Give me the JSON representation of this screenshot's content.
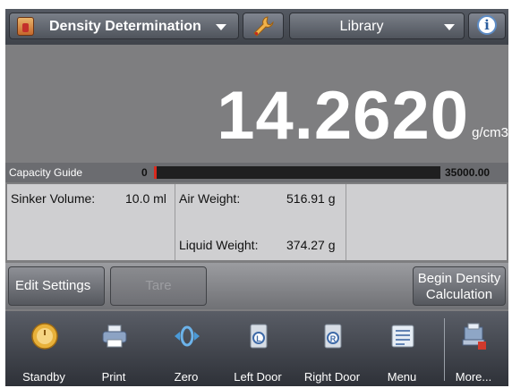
{
  "header": {
    "mode_label": "Density Determination",
    "library_label": "Library"
  },
  "reading": {
    "value": "14.2620",
    "unit": "g/cm3"
  },
  "capacity": {
    "label": "Capacity Guide",
    "min": "0",
    "max": "35000.00",
    "fill_fraction": 0.005
  },
  "details": {
    "sinker_label": "Sinker Volume:",
    "sinker_value": "10.0 ml",
    "air_label": "Air Weight:",
    "air_value": "516.91 g",
    "liquid_label": "Liquid Weight:",
    "liquid_value": "374.27 g"
  },
  "actions": {
    "edit_settings": "Edit Settings",
    "tare": "Tare",
    "begin_line1": "Begin Density",
    "begin_line2": "Calculation"
  },
  "nav": {
    "standby": "Standby",
    "print": "Print",
    "zero": "Zero",
    "left_door": "Left Door",
    "right_door": "Right Door",
    "menu": "Menu",
    "more": "More..."
  },
  "colors": {
    "accent_red": "#d9291d",
    "background_gray": "#7e7e80",
    "nav_dark": "#2e3138"
  }
}
